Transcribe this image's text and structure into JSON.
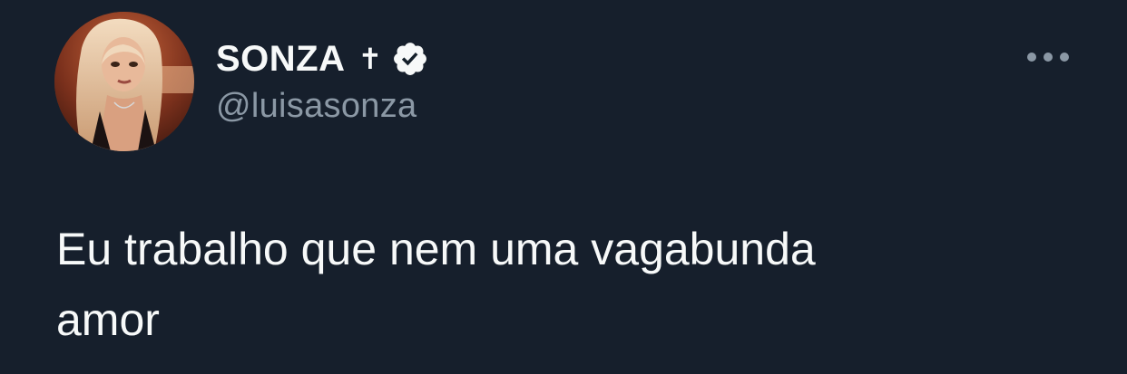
{
  "tweet": {
    "author": {
      "display_name": "SONZA",
      "name_emoji": "✝",
      "handle": "@luisasonza",
      "verified": true,
      "avatar_icon": "profile-photo"
    },
    "text": "Eu trabalho que nem uma vagabunda\namor",
    "more_icon": "ellipsis-icon"
  },
  "colors": {
    "background": "#15202b",
    "primary_text": "#f7f9f9",
    "secondary_text": "#8b98a5"
  }
}
